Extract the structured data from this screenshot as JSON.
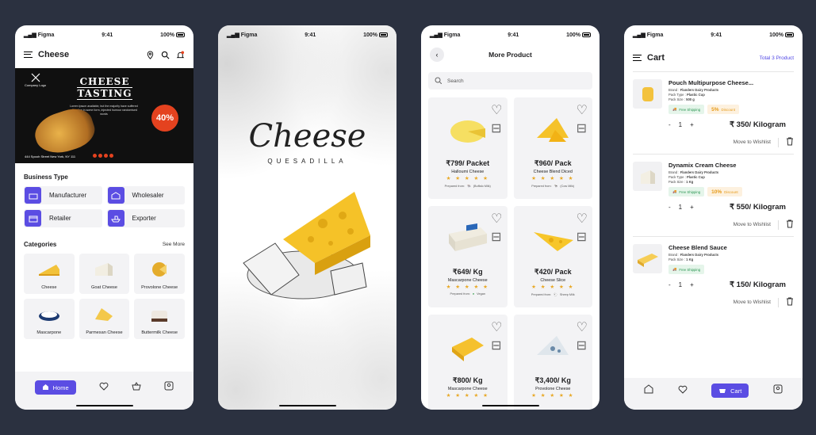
{
  "status": {
    "carrier": "Figma",
    "time": "9:41",
    "battery": "100%"
  },
  "home": {
    "title": "Cheese",
    "banner": {
      "logo_text": "Company Logo",
      "title_line1": "CHEESE",
      "title_line2": "TASTING",
      "text": "Lorem Ipsum available, but the majority have suffered alteration in some form, injected humour randomised words",
      "discount": "40%",
      "address": "444 Spooh Street New York, NY 111"
    },
    "business_title": "Business Type",
    "business": [
      "Manufacturer",
      "Wholesaler",
      "Retailer",
      "Exporter"
    ],
    "categories_title": "Categories",
    "see_more": "See More",
    "categories": [
      "Cheese",
      "Goat Cheese",
      "Provolone Cheese",
      "Mascarpone",
      "Parmesan Cheese",
      "Buttermilk Cheese"
    ],
    "nav_home": "Home"
  },
  "splash": {
    "title": "Cheese",
    "subtitle": "QUESADILLA"
  },
  "products": {
    "title": "More Product",
    "search_placeholder": "Search",
    "prepared_label": "Prepared from:",
    "items": [
      {
        "price": "₹799/ Packet",
        "name": "Halloumi Cheese",
        "source": "(Buffalo Milk)"
      },
      {
        "price": "₹960/ Pack",
        "name": "Cheese Blend Diced",
        "source": "(Cow Milk)"
      },
      {
        "price": "₹649/ Kg",
        "name": "Mascarpone Cheese",
        "source": "Vegan"
      },
      {
        "price": "₹420/ Pack",
        "name": "Cheese Slice",
        "source": "Sheep Milk"
      },
      {
        "price": "₹800/ Kg",
        "name": "Mascarpone Cheese",
        "source": ""
      },
      {
        "price": "₹3,400/ Kg",
        "name": "Provolone Cheese",
        "source": ""
      }
    ],
    "stars": "★ ★ ★ ★ ★"
  },
  "cart": {
    "title": "Cart",
    "total": "Total 3 Product",
    "brand_label": "Brand :",
    "pack_type_label": "Pack Type :",
    "pack_size_label": "Pack Size :",
    "free_shipping": "Free Shipping",
    "discount_label": "Discount",
    "move_to_wishlist": "Move to Wishlist",
    "nav_cart": "Cart",
    "items": [
      {
        "name": "Pouch Multipurpose Cheese...",
        "brand": "Flanders Dairy Products",
        "pack_type": "Plastic Cup",
        "pack_size": "500 g",
        "discount": "5%",
        "qty": "1",
        "price": "₹ 350/ Kilogram"
      },
      {
        "name": "Dynamix Cream Cheese",
        "brand": "Flanders Dairy Products",
        "pack_type": "Plastic Cup",
        "pack_size": "1 Kg",
        "discount": "10%",
        "qty": "1",
        "price": "₹ 550/ Kilogram"
      },
      {
        "name": "Cheese Blend Sauce",
        "brand": "Flanders Dairy Products",
        "pack_type": "",
        "pack_size": "1 Kg",
        "discount": "",
        "qty": "1",
        "price": "₹ 150/ Kilogram"
      }
    ]
  },
  "colors": {
    "accent": "#5b4de3",
    "background": "#2b3140",
    "star": "#e8a825",
    "discount_red": "#e4421f"
  }
}
